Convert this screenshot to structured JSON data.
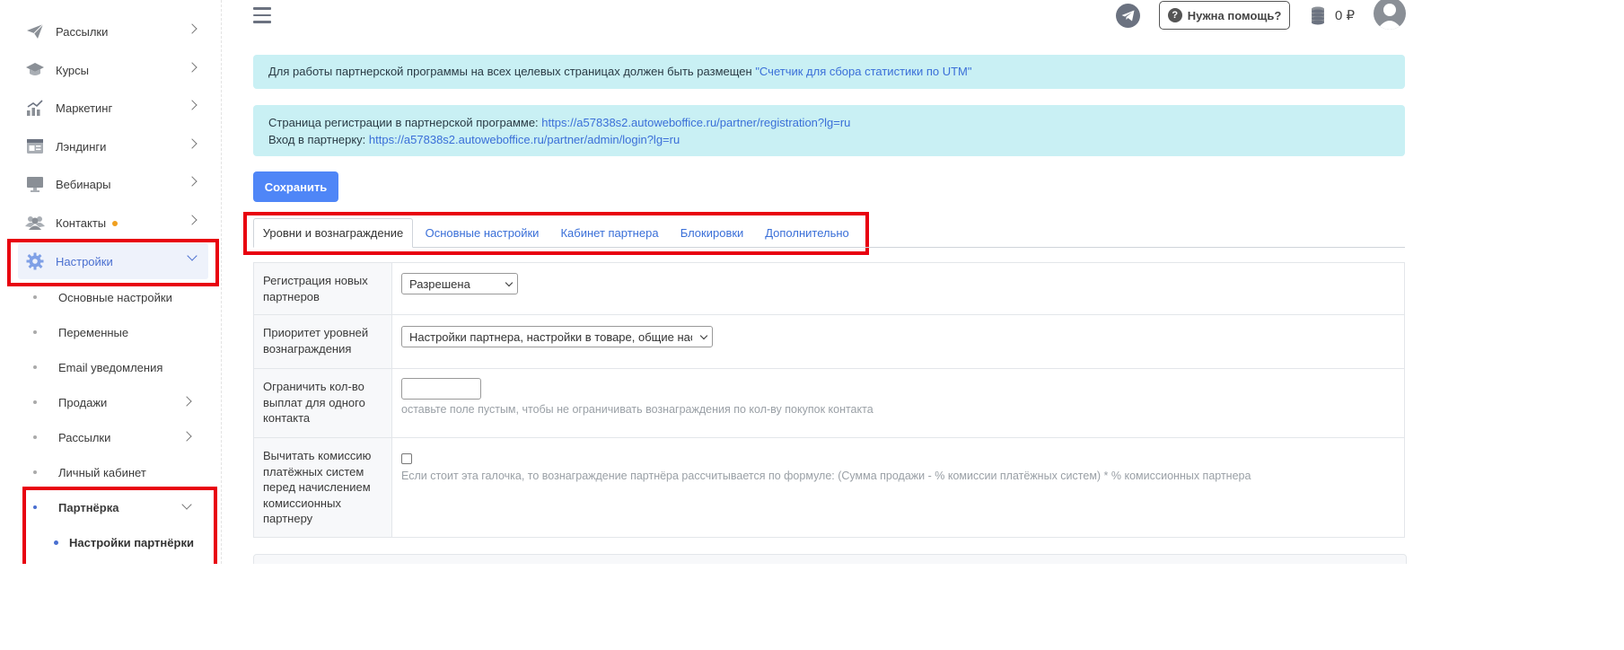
{
  "sidebar": {
    "items": [
      {
        "label": "Рассылки",
        "icon": "paper-plane-icon"
      },
      {
        "label": "Курсы",
        "icon": "graduation-cap-icon"
      },
      {
        "label": "Маркетинг",
        "icon": "chart-growth-icon"
      },
      {
        "label": "Лэндинги",
        "icon": "landing-page-icon"
      },
      {
        "label": "Вебинары",
        "icon": "monitor-icon"
      },
      {
        "label": "Контакты",
        "icon": "users-icon",
        "badge": "orange-dot"
      },
      {
        "label": "Настройки",
        "icon": "gear-icon",
        "active": true
      }
    ],
    "sub_items": [
      {
        "label": "Основные настройки"
      },
      {
        "label": "Переменные"
      },
      {
        "label": "Email уведомления"
      },
      {
        "label": "Продажи"
      },
      {
        "label": "Рассылки"
      },
      {
        "label": "Личный кабинет"
      },
      {
        "label": "Партнёрка"
      }
    ],
    "subsub_items": [
      {
        "label": "Настройки партнёрки"
      }
    ]
  },
  "header": {
    "help_label": "Нужна помощь?",
    "help_icon_glyph": "?",
    "balance": "0 ₽"
  },
  "alerts": {
    "utm_text": "Для работы партнерской программы на всех целевых страницах должен быть размещен ",
    "utm_link": "\"Счетчик для сбора статистики по UTM\"",
    "reg_label": "Страница регистрации в партнерской программе: ",
    "reg_link": "https://a57838s2.autoweboffice.ru/partner/registration?lg=ru",
    "login_label": "Вход в партнерку: ",
    "login_link": "https://a57838s2.autoweboffice.ru/partner/admin/login?lg=ru"
  },
  "save_label": "Сохранить",
  "tabs": [
    {
      "label": "Уровни и вознаграждение",
      "active": true
    },
    {
      "label": "Основные настройки"
    },
    {
      "label": "Кабинет партнера"
    },
    {
      "label": "Блокировки"
    },
    {
      "label": "Дополнительно"
    }
  ],
  "form": {
    "rows": [
      {
        "label": "Регистрация новых партнеров",
        "select_value": "Разрешена"
      },
      {
        "label": "Приоритет уровней вознаграждения",
        "select_value": "Настройки партнера, настройки в товаре, общие настройки"
      },
      {
        "label": "Ограничить кол-во выплат для одного контакта",
        "input_value": "",
        "hint": "оставьте поле пустым, чтобы не ограничивать вознаграждения по кол-ву покупок контакта"
      },
      {
        "label": "Вычитать комиссию платёжных систем перед начислением комиссионных партнеру",
        "checked": false,
        "hint": "Если стоит эта галочка, то вознаграждение партнёра рассчитывается по формуле: (Сумма продажи - % комиссии платёжных систем) * % комиссионных партнера"
      }
    ]
  },
  "colors": {
    "accent": "#4f86f7",
    "link": "#3a6fd8",
    "alert_bg": "#c9f0f4",
    "highlight_border": "#e8000f"
  }
}
